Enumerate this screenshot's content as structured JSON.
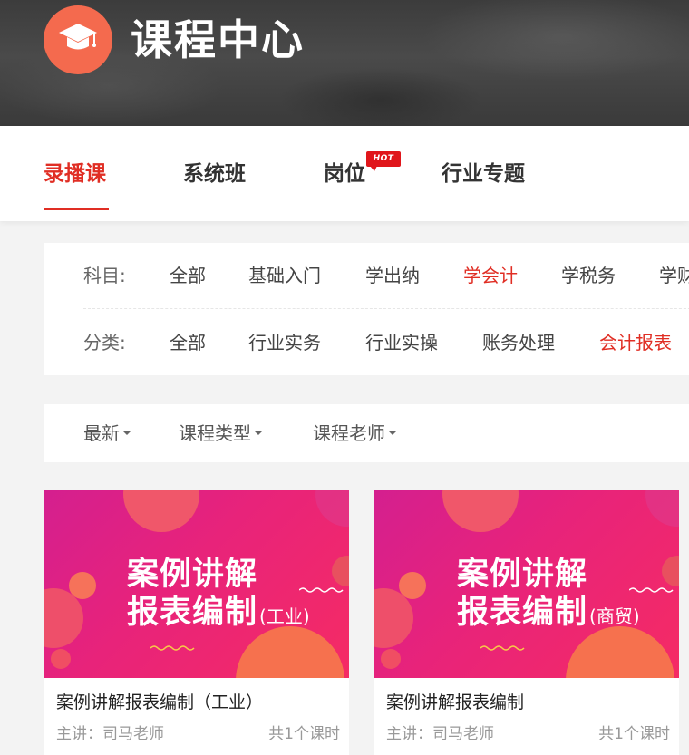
{
  "banner": {
    "title": "课程中心",
    "logo_icon": "graduation-cap-icon",
    "logo_color": "#f46a4e"
  },
  "tabs": [
    {
      "label": "录播课",
      "active": true
    },
    {
      "label": "系统班",
      "active": false
    },
    {
      "label": "岗位",
      "active": false,
      "badge": "HOT"
    },
    {
      "label": "行业专题",
      "active": false
    }
  ],
  "filters": {
    "subject": {
      "label": "科目:",
      "options": [
        "全部",
        "基础入门",
        "学出纳",
        "学会计",
        "学税务",
        "学财"
      ],
      "selected": "学会计"
    },
    "category": {
      "label": "分类:",
      "options": [
        "全部",
        "行业实务",
        "行业实操",
        "账务处理",
        "会计报表"
      ],
      "selected": "会计报表"
    }
  },
  "sort": [
    "最新",
    "课程类型",
    "课程老师"
  ],
  "courses": [
    {
      "thumb_line1": "案例讲解",
      "thumb_line2": "报表编制",
      "thumb_tag": "(工业)",
      "title": "案例讲解报表编制（工业）",
      "teacher": "主讲：司马老师",
      "lessons": "共1个课时"
    },
    {
      "thumb_line1": "案例讲解",
      "thumb_line2": "报表编制",
      "thumb_tag": "(商贸)",
      "title": "案例讲解报表编制",
      "teacher": "主讲：司马老师",
      "lessons": "共1个课时"
    }
  ],
  "colors": {
    "accent": "#e02e24",
    "thumb_gradient_start": "#d41f8f",
    "thumb_gradient_end": "#f52b64"
  }
}
